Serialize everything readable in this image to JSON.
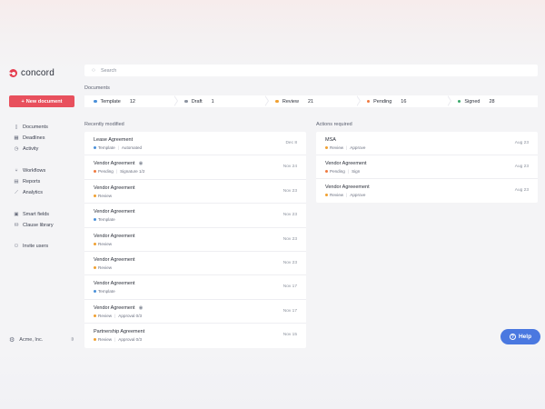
{
  "app": {
    "name": "concord",
    "brand_color": "#e53d4f"
  },
  "sidebar": {
    "new_button_icon": "+",
    "new_button_label": "New document",
    "nav_groups": [
      [
        {
          "label": "Documents",
          "icon": "document-icon",
          "glyph": "▯"
        },
        {
          "label": "Deadlines",
          "icon": "calendar-icon",
          "glyph": "▦"
        },
        {
          "label": "Activity",
          "icon": "clock-icon",
          "glyph": "◷"
        }
      ],
      [
        {
          "label": "Workflows",
          "icon": "workflow-icon",
          "glyph": "⑂"
        },
        {
          "label": "Reports",
          "icon": "report-icon",
          "glyph": "▤"
        },
        {
          "label": "Analytics",
          "icon": "analytics-icon",
          "glyph": "⟋"
        }
      ],
      [
        {
          "label": "Smart fields",
          "icon": "fields-icon",
          "glyph": "▣"
        },
        {
          "label": "Clause library",
          "icon": "library-icon",
          "glyph": "⛁"
        }
      ],
      [
        {
          "label": "Invite users",
          "icon": "invite-user-icon",
          "glyph": "⚇"
        }
      ]
    ],
    "org_name": "Acme, Inc.",
    "org_glyph": "⚙",
    "org_switch_glyph": "⇳"
  },
  "search": {
    "icon_glyph": "○",
    "placeholder": "Search"
  },
  "documents": {
    "title": "Documents",
    "stages": [
      {
        "label": "Template",
        "count": "12",
        "color": "#4a90d9"
      },
      {
        "label": "Draft",
        "count": "1",
        "color": "#8c93a0"
      },
      {
        "label": "Review",
        "count": "21",
        "color": "#f0a030"
      },
      {
        "label": "Pending",
        "count": "16",
        "color": "#f07a40"
      },
      {
        "label": "Signed",
        "count": "28",
        "color": "#3aa86b"
      }
    ]
  },
  "recently_modified": {
    "title": "Recently modified",
    "rows": [
      {
        "title": "Lease Agreement",
        "status": "Template",
        "color": "#4a90d9",
        "extra": "Automated",
        "date": "Dec 8",
        "viewed": false
      },
      {
        "title": "Vendor Agreement",
        "status": "Pending",
        "color": "#f07a40",
        "extra": "Signature 1/2",
        "date": "Nov 24",
        "viewed": true
      },
      {
        "title": "Vendor Agreement",
        "status": "Review",
        "color": "#f0a030",
        "extra": "",
        "date": "Nov 23",
        "viewed": false
      },
      {
        "title": "Vendor Agreement",
        "status": "Template",
        "color": "#4a90d9",
        "extra": "",
        "date": "Nov 23",
        "viewed": false
      },
      {
        "title": "Vendor Agreement",
        "status": "Review",
        "color": "#f0a030",
        "extra": "",
        "date": "Nov 23",
        "viewed": false
      },
      {
        "title": "Vendor Agreement",
        "status": "Review",
        "color": "#f0a030",
        "extra": "",
        "date": "Nov 23",
        "viewed": false
      },
      {
        "title": "Vendor Agreement",
        "status": "Template",
        "color": "#4a90d9",
        "extra": "",
        "date": "Nov 17",
        "viewed": false
      },
      {
        "title": "Vendor Agreement",
        "status": "Review",
        "color": "#f0a030",
        "extra": "Approval 0/3",
        "date": "Nov 17",
        "viewed": true
      },
      {
        "title": "Partnership Agreement",
        "status": "Review",
        "color": "#f0a030",
        "extra": "Approval 0/3",
        "date": "Nov 15",
        "viewed": false
      }
    ]
  },
  "actions_required": {
    "title": "Actions required",
    "rows": [
      {
        "title": "MSA",
        "status": "Review",
        "color": "#f0a030",
        "extra": "Approve",
        "date": "Aug 23"
      },
      {
        "title": "Vendor Agreement",
        "status": "Pending",
        "color": "#f07a40",
        "extra": "Sign",
        "date": "Aug 23"
      },
      {
        "title": "Vendor Agreeement",
        "status": "Review",
        "color": "#f0a030",
        "extra": "Approve",
        "date": "Aug 23"
      }
    ]
  },
  "help": {
    "label": "Help",
    "glyph": "?"
  }
}
